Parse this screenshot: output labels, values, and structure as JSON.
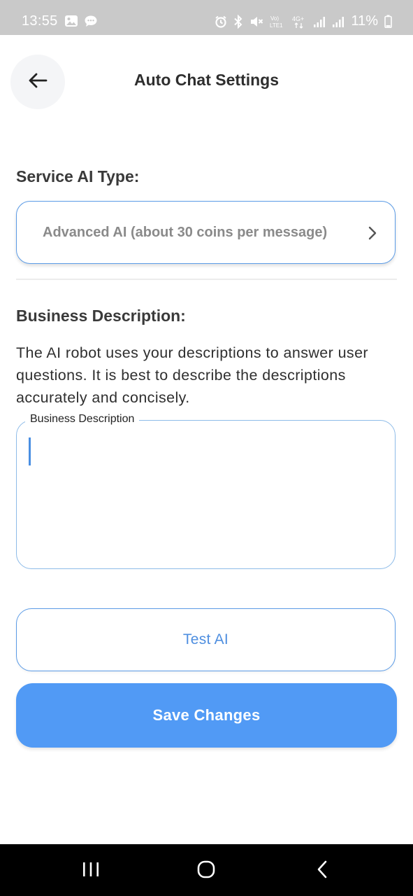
{
  "status_bar": {
    "time": "13:55",
    "battery": "11%",
    "network": "4G+",
    "left_icons": [
      "image-icon",
      "chat-bubble-icon"
    ],
    "right_icons": [
      "alarm-icon",
      "bluetooth-icon",
      "mute-icon",
      "volte-icon",
      "4g-plus-icon",
      "signal-icon",
      "signal-icon",
      "battery-icon"
    ]
  },
  "header": {
    "title": "Auto Chat Settings",
    "back_icon": "arrow-left-icon"
  },
  "service_ai": {
    "label": "Service AI Type:",
    "selected_value": "Advanced AI (about 30 coins per message)",
    "chevron_icon": "chevron-right-icon"
  },
  "business": {
    "label": "Business Description:",
    "help_text": "The AI robot uses your descriptions to answer user questions. It is best to describe the descriptions accurately and concisely.",
    "field_label": "Business Description",
    "field_value": ""
  },
  "actions": {
    "test_label": "Test AI",
    "save_label": "Save Changes"
  },
  "colors": {
    "accent": "#519af5",
    "outline": "#5b9be6",
    "status_bar_bg": "#c9c9c9",
    "nav_bar_bg": "#000000"
  },
  "nav_bar": {
    "icons": [
      "recent-apps-icon",
      "home-icon",
      "back-nav-icon"
    ]
  }
}
